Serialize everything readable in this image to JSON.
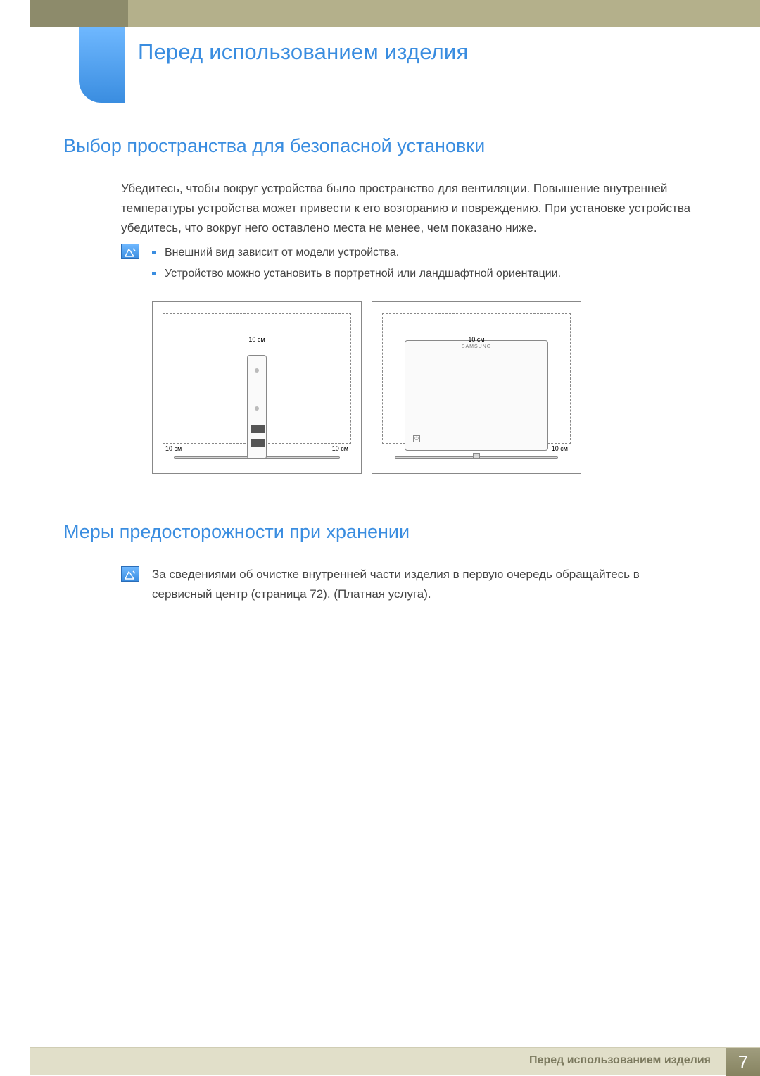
{
  "chapter_title": "Перед использованием изделия",
  "section1": {
    "title": "Выбор пространства для безопасной установки",
    "paragraph": "Убедитесь, чтобы вокруг устройства было пространство для вентиляции. Повышение внутренней температуры устройства может привести к его возгоранию и повреждению. При установке устройства убедитесь, что вокруг него оставлено места не менее, чем показано ниже.",
    "notes": [
      "Внешний вид зависит от модели устройства.",
      "Устройство можно установить в портретной или ландшафтной ориентации."
    ]
  },
  "diagram": {
    "clearance": "10 см",
    "brand": "SAMSUNG"
  },
  "section2": {
    "title": "Меры предосторожности при хранении",
    "note": "За сведениями об очистке внутренней части изделия в первую очередь обращайтесь в сервисный центр (страница 72). (Платная услуга)."
  },
  "footer": {
    "text": "Перед использованием изделия",
    "page": "7"
  }
}
